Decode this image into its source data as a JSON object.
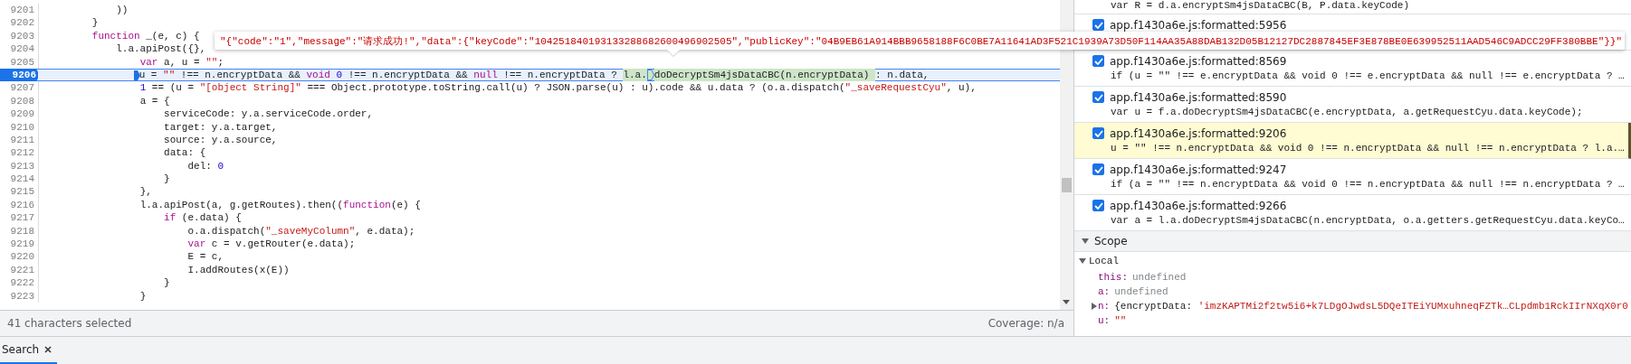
{
  "editor": {
    "lines": [
      {
        "number": "9201",
        "current": false,
        "segments": [
          {
            "kind": "plain",
            "text": "            ))"
          }
        ]
      },
      {
        "number": "9202",
        "current": false,
        "segments": [
          {
            "kind": "plain",
            "text": "        }"
          }
        ]
      },
      {
        "number": "9203",
        "current": false,
        "segments": [
          {
            "kind": "keyword",
            "text": "        function"
          },
          {
            "kind": "plain",
            "text": " _(e, c) {"
          }
        ]
      },
      {
        "number": "9204",
        "current": false,
        "segments": [
          {
            "kind": "plain",
            "text": "            l.a.apiPost({},"
          }
        ]
      },
      {
        "number": "9205",
        "current": false,
        "segments": [
          {
            "kind": "keyword",
            "text": "                var"
          },
          {
            "kind": "plain",
            "text": " a, u = "
          },
          {
            "kind": "string",
            "text": "\"\""
          },
          {
            "kind": "plain",
            "text": ";"
          }
        ]
      },
      {
        "number": "9206",
        "current": true,
        "segments": [
          {
            "kind": "pause_marker"
          },
          {
            "kind": "plain",
            "text": "                u = "
          },
          {
            "kind": "string",
            "text": "\"\""
          },
          {
            "kind": "plain",
            "text": " !== n.encryptData && "
          },
          {
            "kind": "keyword",
            "text": "void"
          },
          {
            "kind": "number",
            "text": " 0"
          },
          {
            "kind": "plain",
            "text": " !== n.encryptData && "
          },
          {
            "kind": "keyword",
            "text": "null"
          },
          {
            "kind": "plain",
            "text": " !== n.encryptData ? "
          },
          {
            "kind": "evaluated",
            "text": "l.a."
          },
          {
            "kind": "step_marker"
          },
          {
            "kind": "evaluated",
            "text": "doDecryptSm4jsDataCBC(n.encryptData) "
          },
          {
            "kind": "plain",
            "text": ": n.data,"
          }
        ]
      },
      {
        "number": "9207",
        "current": false,
        "segments": [
          {
            "kind": "number",
            "text": "                1"
          },
          {
            "kind": "plain",
            "text": " == (u = "
          },
          {
            "kind": "string",
            "text": "\"[object String]\""
          },
          {
            "kind": "plain",
            "text": " === Object.prototype.toString.call(u) ? JSON.parse(u) : u).code && u.data ? (o.a.dispatch("
          },
          {
            "kind": "string",
            "text": "\"_saveRequestCyu\""
          },
          {
            "kind": "plain",
            "text": ", u),"
          }
        ]
      },
      {
        "number": "9208",
        "current": false,
        "segments": [
          {
            "kind": "plain",
            "text": "                a = {"
          }
        ]
      },
      {
        "number": "9209",
        "current": false,
        "segments": [
          {
            "kind": "plain",
            "text": "                    serviceCode: y.a.serviceCode.order,"
          }
        ]
      },
      {
        "number": "9210",
        "current": false,
        "segments": [
          {
            "kind": "plain",
            "text": "                    target: y.a.target,"
          }
        ]
      },
      {
        "number": "9211",
        "current": false,
        "segments": [
          {
            "kind": "plain",
            "text": "                    source: y.a.source,"
          }
        ]
      },
      {
        "number": "9212",
        "current": false,
        "segments": [
          {
            "kind": "plain",
            "text": "                    data: {"
          }
        ]
      },
      {
        "number": "9213",
        "current": false,
        "segments": [
          {
            "kind": "plain",
            "text": "                        del: "
          },
          {
            "kind": "number",
            "text": "0"
          }
        ]
      },
      {
        "number": "9214",
        "current": false,
        "segments": [
          {
            "kind": "plain",
            "text": "                    }"
          }
        ]
      },
      {
        "number": "9215",
        "current": false,
        "segments": [
          {
            "kind": "plain",
            "text": "                },"
          }
        ]
      },
      {
        "number": "9216",
        "current": false,
        "segments": [
          {
            "kind": "plain",
            "text": "                l.a.apiPost(a, g.getRoutes).then(("
          },
          {
            "kind": "keyword",
            "text": "function"
          },
          {
            "kind": "plain",
            "text": "(e) {"
          }
        ]
      },
      {
        "number": "9217",
        "current": false,
        "segments": [
          {
            "kind": "keyword",
            "text": "                    if"
          },
          {
            "kind": "plain",
            "text": " (e.data) {"
          }
        ]
      },
      {
        "number": "9218",
        "current": false,
        "segments": [
          {
            "kind": "plain",
            "text": "                        o.a.dispatch("
          },
          {
            "kind": "string",
            "text": "\"_saveMyColumn\""
          },
          {
            "kind": "plain",
            "text": ", e.data);"
          }
        ]
      },
      {
        "number": "9219",
        "current": false,
        "segments": [
          {
            "kind": "keyword",
            "text": "                        var"
          },
          {
            "kind": "plain",
            "text": " c = v.getRouter(e.data);"
          }
        ]
      },
      {
        "number": "9220",
        "current": false,
        "segments": [
          {
            "kind": "plain",
            "text": "                        E = c,"
          }
        ]
      },
      {
        "number": "9221",
        "current": false,
        "segments": [
          {
            "kind": "plain",
            "text": "                        I.addRoutes(x(E))"
          }
        ]
      },
      {
        "number": "9222",
        "current": false,
        "segments": [
          {
            "kind": "plain",
            "text": "                    }"
          }
        ]
      },
      {
        "number": "9223",
        "current": false,
        "segments": [
          {
            "kind": "plain",
            "text": "                }"
          }
        ]
      }
    ]
  },
  "tooltip": {
    "text": "\"{\"code\":\"1\",\"message\":\"请求成功!\",\"data\":{\"keyCode\":\"104251840193133288682600496902505\",\"publicKey\":\"04B9EB61A914BBB9658188F6C0BE7A11641AD3F521C1939A73D50F114AA35A88DAB132D05B12127DC2887845EF3E878BE0E639952511AAD546C9ADCC29FF380BBE\"}}\""
  },
  "status_bar": {
    "selection": "41 characters selected",
    "coverage": "Coverage: n/a"
  },
  "breakpoints": {
    "top_snippet": "var R = d.a.encryptSm4jsDataCBC(B, P.data.keyCode)",
    "items": [
      {
        "location": "app.f1430a6e.js:formatted:5956",
        "checked": true,
        "selected": false
      },
      {
        "location": "app.f1430a6e.js:formatted:8569",
        "snippet": "if (u = \"\" !== e.encryptData && void 0 !== e.encryptData && null !== e.encryptData ? …",
        "checked": true,
        "selected": false
      },
      {
        "location": "app.f1430a6e.js:formatted:8590",
        "snippet": "var u = f.a.doDecryptSm4jsDataCBC(e.encryptData, a.getRequestCyu.data.keyCode);",
        "checked": true,
        "selected": false
      },
      {
        "location": "app.f1430a6e.js:formatted:9206",
        "snippet": "u = \"\" !== n.encryptData && void 0 !== n.encryptData && null !== n.encryptData ? l.a.…",
        "checked": true,
        "selected": true
      },
      {
        "location": "app.f1430a6e.js:formatted:9247",
        "snippet": "if (a = \"\" !== n.encryptData && void 0 !== n.encryptData && null !== n.encryptData ? …",
        "checked": true,
        "selected": false
      },
      {
        "location": "app.f1430a6e.js:formatted:9266",
        "snippet": "var a = l.a.doDecryptSm4jsDataCBC(n.encryptData, o.a.getters.getRequestCyu.data.keyCo…",
        "checked": true,
        "selected": false
      }
    ]
  },
  "scope": {
    "title": "Scope",
    "expanded": true,
    "groups": [
      {
        "name": "Local",
        "expanded": true,
        "vars": [
          {
            "name": "this:",
            "kind": "primitive",
            "segments": [
              {
                "kind": "undefined",
                "text": "undefined"
              }
            ]
          },
          {
            "name": "a:",
            "kind": "primitive",
            "segments": [
              {
                "kind": "undefined",
                "text": "undefined"
              }
            ]
          },
          {
            "name": "n:",
            "kind": "object",
            "segments": [
              {
                "kind": "plain",
                "text": "{encryptData: "
              },
              {
                "kind": "string",
                "text": "'imzKAPTMi2f2tw5i6+k7LDgOJwdsL5DQeITEiYUMxuhneqFZTk…CLpdmb1RckIIrNXqX0r0"
              }
            ]
          },
          {
            "name": "u:",
            "kind": "primitive",
            "segments": [
              {
                "kind": "string",
                "text": "\"\""
              }
            ]
          }
        ]
      }
    ]
  },
  "drawer": {
    "tabs": [
      {
        "label": "Search",
        "selected": true
      }
    ]
  }
}
